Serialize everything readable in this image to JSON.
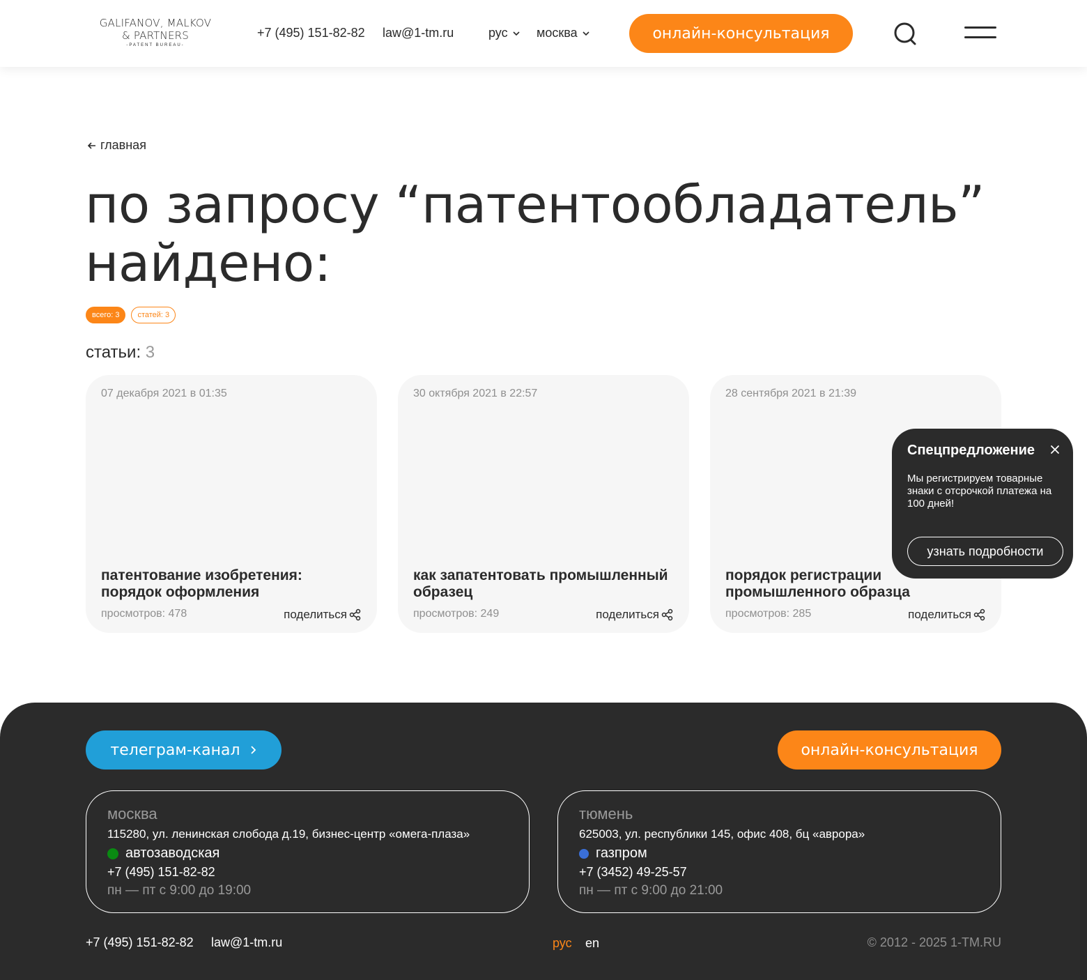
{
  "header": {
    "logo": {
      "line1": "GALIFANOV, MALKOV",
      "line2": "& PARTNERS",
      "line3": "-PATENT BUREAU-"
    },
    "phone": "+7 (495) 151-82-82",
    "email": "law@1-tm.ru",
    "language": "рус",
    "city": "москва",
    "cta_label": "онлайн-консультация",
    "icons": {
      "search": "search-icon",
      "menu": "hamburger-menu-icon",
      "chevron": "chevron-down-icon"
    }
  },
  "breadcrumb": {
    "back_label": "главная",
    "icon": "arrow-left-icon"
  },
  "page_title": "по запросу “патентообладатель” найдено:",
  "chips": [
    {
      "label": "всего: 3",
      "active": true
    },
    {
      "label": "статей: 3",
      "active": false
    }
  ],
  "section": {
    "label": "статьи:",
    "count": "3"
  },
  "articles": [
    {
      "date": "07 декабря 2021 в 01:35",
      "title": "патентование изобретения: порядок оформления",
      "views": "просмотров: 478",
      "share_label": "поделиться"
    },
    {
      "date": "30 октября 2021 в 22:57",
      "title": "как запатентовать промышленный образец",
      "views": "просмотров: 249",
      "share_label": "поделиться"
    },
    {
      "date": "28 сентября 2021 в 21:39",
      "title": "порядок регистрации промышленного образца",
      "views": "просмотров: 285",
      "share_label": "поделиться"
    }
  ],
  "promo": {
    "title": "Спецпредложение",
    "text": "Мы регистрируем товарные знаки с отсрочкой платежа на 100 дней!",
    "button_label": "узнать подробности"
  },
  "footer": {
    "telegram_label": "телеграм-канал",
    "cta_label": "онлайн-консультация",
    "offices": [
      {
        "city": "москва",
        "address": "115280, ул. ленинская слобода д.19, бизнес-центр «омега-плаза»",
        "metro": "автозаводская",
        "metro_color": "#0a8a12",
        "phone": "+7 (495) 151-82-82",
        "hours": "пн — пт с 9:00 до 19:00"
      },
      {
        "city": "тюмень",
        "address": "625003, ул. республики 145, офис 408, бц «аврора»",
        "metro": "газпром",
        "metro_color": "#3a6fd8",
        "phone": "+7 (3452) 49-25-57",
        "hours": "пн — пт с 9:00 до 21:00"
      }
    ],
    "phone": "+7 (495) 151-82-82",
    "email": "law@1-tm.ru",
    "lang_ru": "рус",
    "lang_en": "en",
    "copyright": "© 2012 - 2025 1-TM.RU"
  },
  "colors": {
    "accent": "#fc8618",
    "telegram": "#219fd8",
    "dark": "#2b2b2b",
    "card_bg": "#f6f6f6"
  }
}
